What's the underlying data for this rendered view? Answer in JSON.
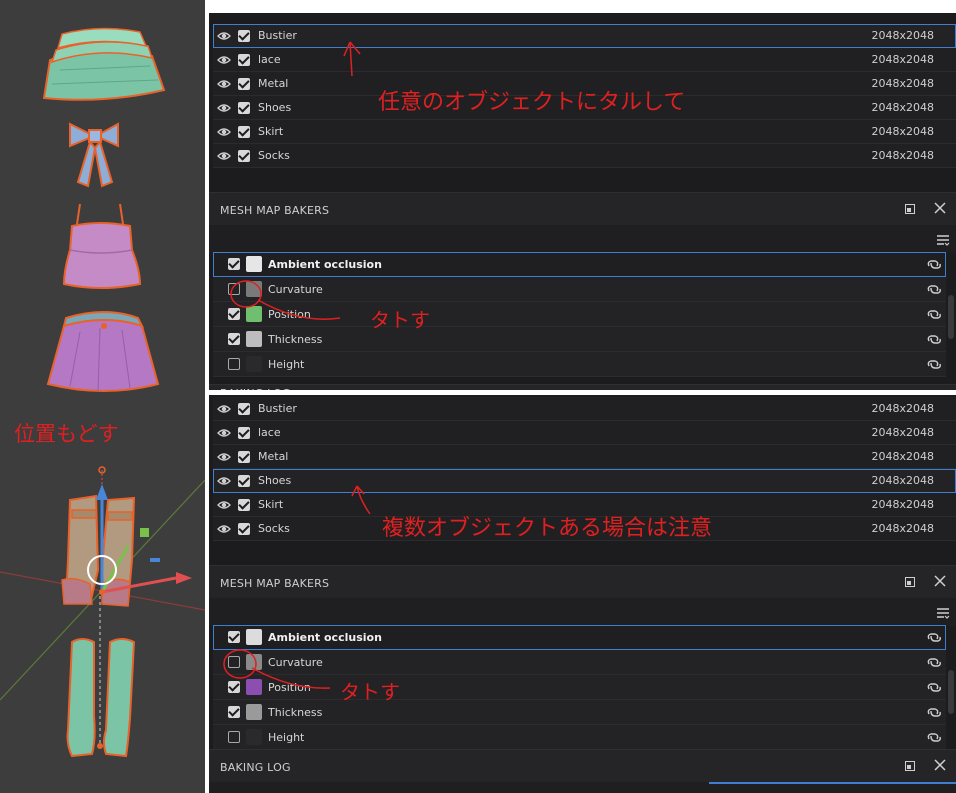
{
  "layers_top": [
    {
      "name": "Bustier",
      "res": "2048x2048",
      "selected": true
    },
    {
      "name": "lace",
      "res": "2048x2048"
    },
    {
      "name": "Metal",
      "res": "2048x2048"
    },
    {
      "name": "Shoes",
      "res": "2048x2048"
    },
    {
      "name": "Skirt",
      "res": "2048x2048"
    },
    {
      "name": "Socks",
      "res": "2048x2048"
    }
  ],
  "layers_bottom": [
    {
      "name": "Bustier",
      "res": "2048x2048"
    },
    {
      "name": "lace",
      "res": "2048x2048"
    },
    {
      "name": "Metal",
      "res": "2048x2048"
    },
    {
      "name": "Shoes",
      "res": "2048x2048",
      "selected": true
    },
    {
      "name": "Skirt",
      "res": "2048x2048"
    },
    {
      "name": "Socks",
      "res": "2048x2048"
    }
  ],
  "sections": {
    "mesh_map_bakers": "MESH MAP BAKERS",
    "baking_log": "BAKING LOG"
  },
  "bakers_top": [
    {
      "name": "Ambient occlusion",
      "checked": true,
      "selected": true,
      "thumb": "#e6e6e6"
    },
    {
      "name": "Curvature",
      "checked": false,
      "thumb": "#7a7a7a"
    },
    {
      "name": "Position",
      "checked": true,
      "thumb": "#6fbf6f"
    },
    {
      "name": "Thickness",
      "checked": true,
      "thumb": "#bdbdbd"
    },
    {
      "name": "Height",
      "checked": false,
      "thumb": "#2a2a2a"
    }
  ],
  "bakers_bottom": [
    {
      "name": "Ambient occlusion",
      "checked": true,
      "selected": true,
      "thumb": "#dcdcdc"
    },
    {
      "name": "Curvature",
      "checked": false,
      "thumb": "#8a8a8a"
    },
    {
      "name": "Position",
      "checked": true,
      "thumb": "#8a4fb0"
    },
    {
      "name": "Thickness",
      "checked": true,
      "thumb": "#9a9a9a"
    },
    {
      "name": "Height",
      "checked": false,
      "thumb": "#2a2a2a"
    }
  ],
  "annotations": {
    "top_note": "任意のオブジェクトにタルして",
    "uncheck_note_top": "タトす",
    "origin_note": "位置もどす",
    "bottom_note": "複数オブジェクトある場合は注意",
    "uncheck_note_bottom": "タトす"
  },
  "colors": {
    "panel_bg": "#1c1c1e",
    "selection_outline": "#3f7fd0",
    "annotation_red": "#e02020",
    "viewport_bg": "#3d3d3d"
  }
}
